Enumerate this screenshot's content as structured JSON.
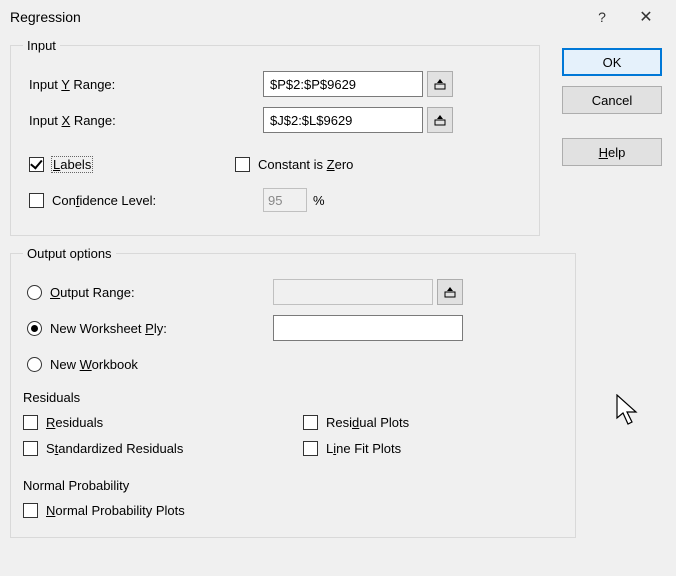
{
  "title": "Regression",
  "buttons": {
    "ok": "OK",
    "cancel": "Cancel",
    "help": "Help"
  },
  "input": {
    "legend": "Input",
    "y_label_pre": "Input ",
    "y_label_u": "Y",
    "y_label_post": " Range:",
    "y_value": "$P$2:$P$9629",
    "x_label_pre": "Input ",
    "x_label_u": "X",
    "x_label_post": " Range:",
    "x_value": "$J$2:$L$9629",
    "labels_u": "L",
    "labels_post": "abels",
    "constzero_pre": "Constant is ",
    "constzero_u": "Z",
    "constzero_post": "ero",
    "conf_pre": "Con",
    "conf_u": "f",
    "conf_post": "idence Level:",
    "conf_value": "95",
    "conf_pct": "%"
  },
  "output": {
    "legend": "Output options",
    "outrange_u": "O",
    "outrange_post": "utput Range:",
    "ply_pre": "New Worksheet ",
    "ply_u": "P",
    "ply_post": "ly:",
    "ply_value": "",
    "wb_pre": "New ",
    "wb_u": "W",
    "wb_post": "orkbook",
    "residuals_head": "Residuals",
    "res_u": "R",
    "res_post": "esiduals",
    "std_pre": "S",
    "std_u": "t",
    "std_post": "andardized Residuals",
    "rplot_pre": "Resi",
    "rplot_u": "d",
    "rplot_post": "ual Plots",
    "lfit_pre": "L",
    "lfit_u": "i",
    "lfit_post": "ne Fit Plots",
    "np_head": "Normal Probability",
    "np_u": "N",
    "np_post": "ormal Probability Plots"
  }
}
